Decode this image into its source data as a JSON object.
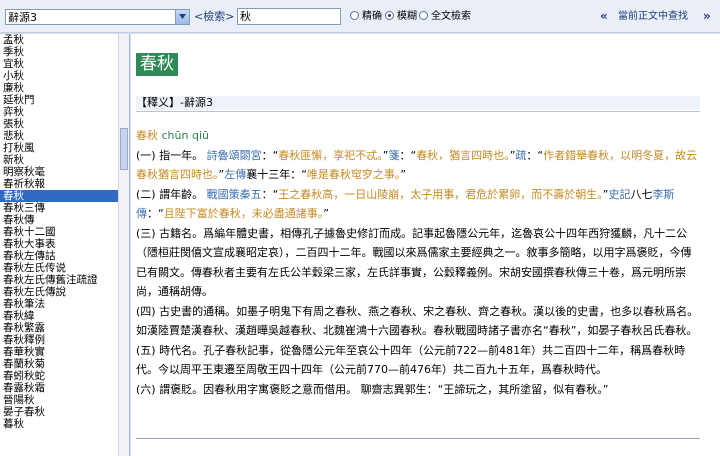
{
  "toolbar": {
    "dictionary": "辭源3",
    "search_label": "<檢索>",
    "query": "秋",
    "options": [
      {
        "label": "精确",
        "selected": false
      },
      {
        "label": "模糊",
        "selected": true
      },
      {
        "label": "全文檢索",
        "selected": false
      }
    ],
    "find_in_text": "當前正文中查找",
    "prev_icon": "double-left-arrow",
    "next_icon": "double-right-arrow"
  },
  "sidebar": {
    "selected_index": 14,
    "items": [
      "孟秋",
      "季秋",
      "宜秋",
      "小秋",
      "廉秋",
      "延秋門",
      "弈秋",
      "張秋",
      "悲秋",
      "打秋風",
      "新秋",
      "明察秋毫",
      "春祈秋報",
      "春秋",
      "春秋三傳",
      "春秋傳",
      "春秋十二國",
      "春秋大事表",
      "春秋左傳詁",
      "春秋左氏传说",
      "春秋左氏傳舊注疏證",
      "春秋左氏傳說",
      "春秋筆法",
      "春秋緯",
      "春秋繁露",
      "春秋釋例",
      "春華秋實",
      "春蘭秋菊",
      "春蚓秋蛇",
      "春露秋霜",
      "晉陽秋",
      "晏子春秋",
      "暮秋"
    ]
  },
  "entry": {
    "headword": "春秋",
    "definition_label": "【釋义】-辭源3",
    "pinyin": "chūn qiū",
    "body_html": "<span class='hw'>春秋</span> <span class='py'>chūn qiū</span><br>(一) 指一年。 <span class='bk'>詩魯頌閟宮</span>：“<span class='qt'>春秋匪懈，享祀不忒。</span>”<span class='bk'>箋</span>：“<span class='qt'>春秋，猶言四時也。</span>”<span class='bk'>疏</span>：“<span class='qt'>作者錯舉春秋，以明冬夏，故云春秋猶言四時也。</span>”<span class='bk'>左傳</span>襄十三年：“<span class='qt'>唯是春秋窀穸之事。</span>”<br>(二) 謂年齡。 <span class='bk'>戰國策秦五</span>：“<span class='qt'>王之春秋高，一日山陵崩，太子用事，君危於累卵，而不壽於朝生。</span>”<span class='bk'>史記</span>八七<span class='bk'>李斯傳</span>：“<span class='qt'>且陛下富於春秋，未必盡通諸事。</span>”<br>(三) 古籍名。爲編年體史書，相傳孔子據魯史修訂而成。記事起魯隱公元年，迄魯哀公十四年西狩獲麟，凡十二公（隱桓莊閔僖文宣成襄昭定哀），二百四十二年。戰國以來爲儒家主要經典之一。敘事多簡略，以用字爲褒貶，今傳已有闕文。傳春秋者主要有左氏公羊穀梁三家，左氏詳事實，公穀釋義例。宋胡安國撰春秋傳三十卷，爲元明所崇尚，通稱胡傳。<br>(四) 古史書的通稱。如墨子明鬼下有周之春秋、燕之春秋、宋之春秋、齊之春秋。漢以後的史書，也多以春秋爲名。如漢陸賈楚漢春秋、漢趙曄吳越春秋、北魏崔鴻十六國春秋。春秋戰國時諸子書亦名“春秋”，如晏子春秋呂氏春秋。<br>(五) 時代名。孔子春秋記事，從魯隱公元年至哀公十四年（公元前722—前481年）共二百四十二年，稱爲春秋時代。今以周平王東遷至周敬王四十四年（公元前770—前476年）共二百九十五年，爲春秋時代。<br>(六) 謂褒貶。因春秋用字寓褒貶之意而借用。 聊齋志異郭生：“王諦玩之，其所塗留，似有春秋。”"
  }
}
